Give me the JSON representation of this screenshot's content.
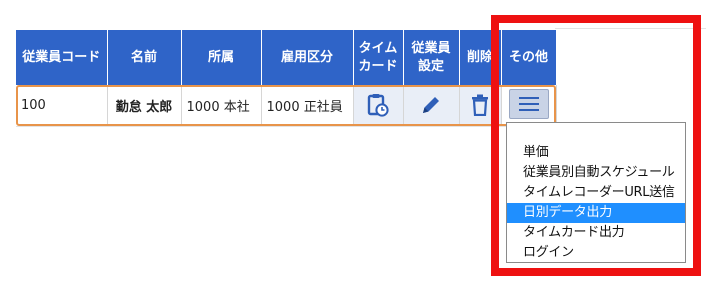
{
  "table": {
    "headers": {
      "employee_code": "従業員コード",
      "name": "名前",
      "department": "所属",
      "employment_type": "雇用区分",
      "timecard_line1": "タイム",
      "timecard_line2": "カード",
      "employee_settings_line1": "従業員",
      "employee_settings_line2": "設定",
      "delete": "削除",
      "other": "その他"
    },
    "row": {
      "employee_code": "100",
      "name": "勤怠 太郎",
      "department": "1000 本社",
      "employment_type": "1000 正社員"
    },
    "icons": {
      "timecard": "clipboard-clock-icon",
      "edit": "pencil-icon",
      "delete": "trash-icon",
      "menu": "hamburger-menu-icon"
    }
  },
  "dropdown": {
    "options": [
      "単価",
      "従業員別自動スケジュール",
      "タイムレコーダーURL送信",
      "日別データ出力",
      "タイムカード出力",
      "ログイン"
    ],
    "selected": "日別データ出力"
  },
  "colors": {
    "header_bg": "#2f64c8",
    "row_outline": "#e8944a",
    "highlight": "#ee1111",
    "selected_option": "#1f8fff",
    "icon_color": "#2f5fb8"
  }
}
